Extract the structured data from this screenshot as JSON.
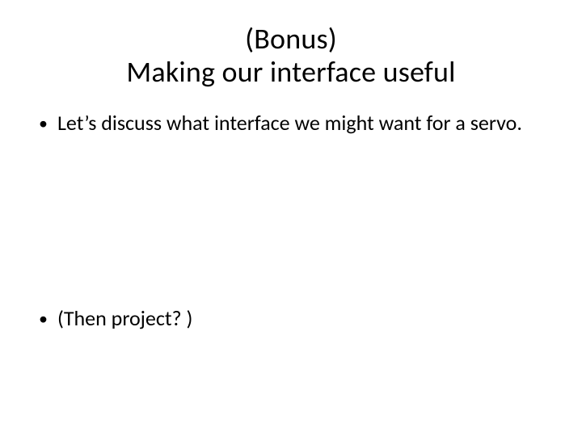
{
  "title": {
    "line1": "(Bonus)",
    "line2": "Making our interface useful"
  },
  "bullets": [
    {
      "text": "Let’s discuss what interface we might want for a servo."
    },
    {
      "text": "(Then project? )"
    }
  ]
}
